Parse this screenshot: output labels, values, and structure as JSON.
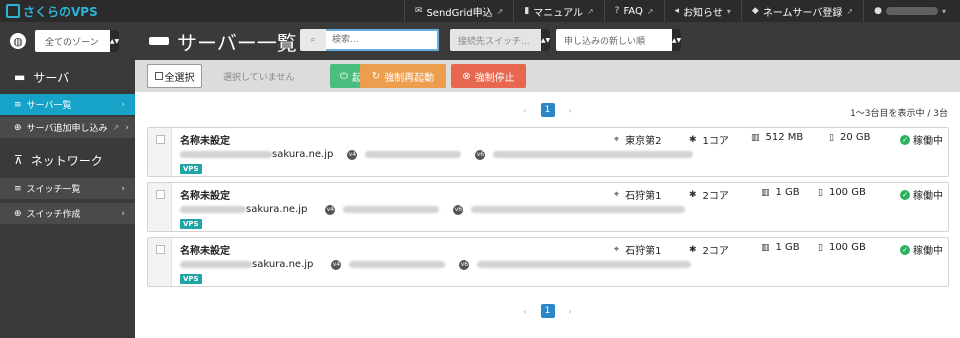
{
  "topbar": {
    "logo": "さくらのVPS",
    "nav": [
      {
        "icon": "envelope-icon",
        "label": "SendGrid申込"
      },
      {
        "icon": "book-icon",
        "label": "マニュアル"
      },
      {
        "icon": "question-icon",
        "label": "FAQ"
      },
      {
        "icon": "megaphone-icon",
        "label": "お知らせ"
      },
      {
        "icon": "tag-icon",
        "label": "ネームサーバ登録"
      }
    ]
  },
  "sidebar": {
    "zone_select": "全てのゾーン",
    "section_server": "サーバ",
    "items_server": [
      {
        "label": "サーバ一覧",
        "active": true
      },
      {
        "label": "サーバ追加申し込み"
      }
    ],
    "section_network": "ネットワーク",
    "items_network": [
      {
        "label": "スイッチ一覧"
      },
      {
        "label": "スイッチ作成"
      }
    ]
  },
  "header": {
    "title": "サーバー一覧",
    "search_placeholder": "検索...",
    "connect_select": "接続先スイッチ...",
    "sort_select": "申し込みの新しい順"
  },
  "toolbar": {
    "select_all": "全選択",
    "status": "選択していません",
    "start": "起動",
    "reboot": "強制再起動",
    "stop": "強制停止"
  },
  "pagination": {
    "current": "1",
    "count_text": "1〜3台目を表示中 / 3台"
  },
  "servers": [
    {
      "name": "名称未設定",
      "host_suffix": "sakura.ne.jp",
      "tag": "VPS",
      "location": "東京第2",
      "cpu": "1コア",
      "memory": "512 MB",
      "disk": "20 GB",
      "status": "稼働中"
    },
    {
      "name": "名称未設定",
      "host_suffix": "sakura.ne.jp",
      "tag": "VPS",
      "location": "石狩第1",
      "cpu": "2コア",
      "memory": "1 GB",
      "disk": "100 GB",
      "status": "稼働中"
    },
    {
      "name": "名称未設定",
      "host_suffix": "sakura.ne.jp",
      "tag": "VPS",
      "location": "石狩第1",
      "cpu": "2コア",
      "memory": "1 GB",
      "disk": "100 GB",
      "status": "稼働中"
    }
  ],
  "colors": {
    "accent": "#17a3c8",
    "start": "#4bbd7e",
    "reboot": "#ec9d4e",
    "stop": "#e8674f",
    "ok": "#2fb05f"
  }
}
